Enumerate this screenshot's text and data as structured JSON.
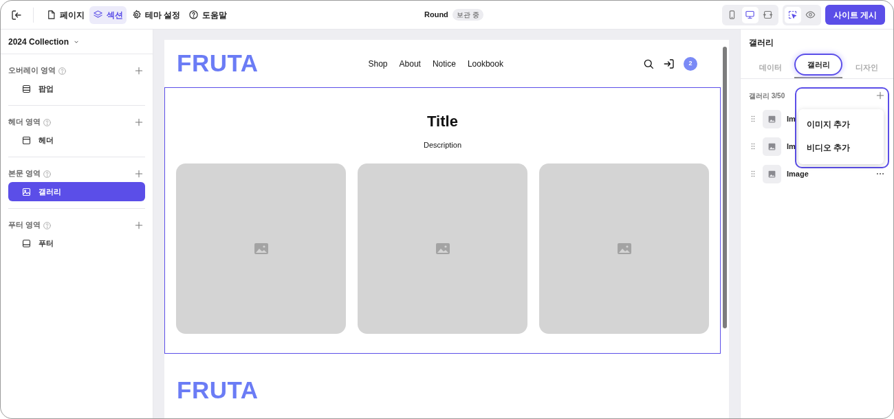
{
  "toolbar": {
    "nav": [
      {
        "label": "페이지",
        "selected": false
      },
      {
        "label": "섹션",
        "selected": true
      },
      {
        "label": "테마 설정",
        "selected": false
      },
      {
        "label": "도움말",
        "selected": false
      }
    ],
    "site_name": "Round",
    "badge": "보관 중",
    "devices": [
      {
        "kind": "mobile",
        "selected": false
      },
      {
        "kind": "desktop",
        "selected": true
      },
      {
        "kind": "fit",
        "selected": false
      }
    ],
    "modes": [
      {
        "kind": "select",
        "selected": true
      },
      {
        "kind": "preview",
        "selected": false
      }
    ],
    "publish": "사이트 게시"
  },
  "sidebar": {
    "collection": "2024 Collection",
    "groups": [
      {
        "title": "오버레이 영역",
        "items": [
          {
            "label": "팝업",
            "selected": false
          }
        ]
      },
      {
        "title": "헤더 영역",
        "items": [
          {
            "label": "헤더",
            "selected": false
          }
        ]
      },
      {
        "title": "본문 영역",
        "items": [
          {
            "label": "갤러리",
            "selected": true
          }
        ]
      },
      {
        "title": "푸터 영역",
        "items": [
          {
            "label": "푸터",
            "selected": false
          }
        ]
      }
    ]
  },
  "preview": {
    "logo": "FRUTA",
    "menu": [
      "Shop",
      "About",
      "Notice",
      "Lookbook"
    ],
    "cart_count": "2",
    "section": {
      "title": "Title",
      "description": "Description",
      "images": [
        {
          "kind": "placeholder"
        },
        {
          "kind": "placeholder"
        },
        {
          "kind": "placeholder"
        }
      ]
    },
    "footer_logo": "FRUTA"
  },
  "panel": {
    "title": "갤러리",
    "tabs": [
      {
        "label": "데이터",
        "selected": false
      },
      {
        "label": "갤러리",
        "selected": true
      },
      {
        "label": "디자인",
        "selected": false
      }
    ],
    "count": "갤러리 3/50",
    "items": [
      {
        "label": "Im",
        "more": false
      },
      {
        "label": "Im",
        "more": false
      },
      {
        "label": "Image",
        "more": true
      }
    ],
    "menu": {
      "open": true,
      "options": [
        "이미지 추가",
        "비디오 추가"
      ]
    }
  }
}
